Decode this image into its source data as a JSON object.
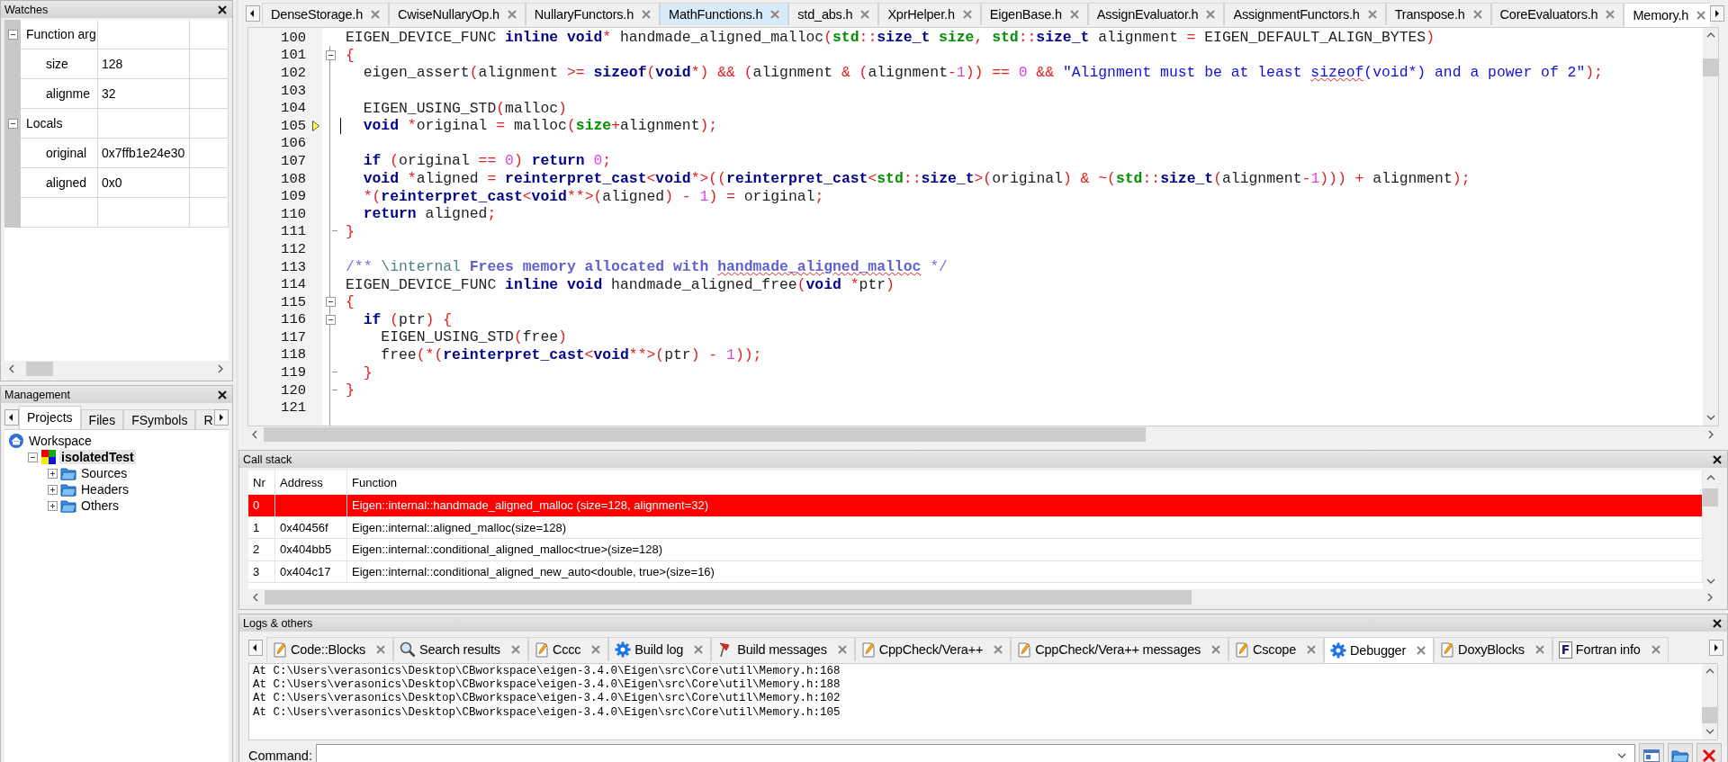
{
  "watches": {
    "title": "Watches",
    "groups": [
      {
        "label": "Function arg",
        "expanded": true,
        "items": [
          {
            "name": "size",
            "value": "128"
          },
          {
            "name": "alignme",
            "value": "32"
          }
        ]
      },
      {
        "label": "Locals",
        "expanded": true,
        "items": [
          {
            "name": "original",
            "value": "0x7ffb1e24e30"
          },
          {
            "name": "aligned",
            "value": "0x0"
          }
        ]
      }
    ]
  },
  "management": {
    "title": "Management",
    "tabs": [
      {
        "label": "Projects",
        "selected": true
      },
      {
        "label": "Files",
        "selected": false
      },
      {
        "label": "FSymbols",
        "selected": false
      },
      {
        "label": "R",
        "selected": false
      }
    ],
    "tree": [
      {
        "label": "Workspace",
        "kind": "workspace",
        "selected": false,
        "children": [
          {
            "label": "isolatedTest",
            "kind": "project",
            "expanded": true,
            "selected": true,
            "children": [
              {
                "label": "Sources",
                "kind": "folder",
                "expanded": false,
                "selected": false
              },
              {
                "label": "Headers",
                "kind": "folder",
                "expanded": false,
                "selected": false
              },
              {
                "label": "Others",
                "kind": "folder",
                "expanded": false,
                "selected": false
              }
            ]
          }
        ]
      }
    ]
  },
  "editor": {
    "tabs": [
      {
        "label": "DenseStorage.h",
        "selected": false,
        "hover": false
      },
      {
        "label": "CwiseNullaryOp.h",
        "selected": false,
        "hover": false
      },
      {
        "label": "NullaryFunctors.h",
        "selected": false,
        "hover": false
      },
      {
        "label": "MathFunctions.h",
        "selected": false,
        "hover": true
      },
      {
        "label": "std_abs.h",
        "selected": false,
        "hover": false
      },
      {
        "label": "XprHelper.h",
        "selected": false,
        "hover": false
      },
      {
        "label": "EigenBase.h",
        "selected": false,
        "hover": false
      },
      {
        "label": "AssignEvaluator.h",
        "selected": false,
        "hover": false
      },
      {
        "label": "AssignmentFunctors.h",
        "selected": false,
        "hover": false
      },
      {
        "label": "Transpose.h",
        "selected": false,
        "hover": false
      },
      {
        "label": "CoreEvaluators.h",
        "selected": false,
        "hover": false
      },
      {
        "label": "Memory.h",
        "selected": true,
        "hover": false
      }
    ],
    "lines": [
      {
        "n": "100",
        "s": [
          {
            "text": "EIGEN_DEVICE_FUNC ",
            "kind": "plain"
          },
          {
            "text": "inline void",
            "kind": "keyword"
          },
          {
            "text": "*",
            "kind": "operator"
          },
          {
            "text": " handmade_aligned_malloc",
            "kind": "plain"
          },
          {
            "text": "(",
            "kind": "operator"
          },
          {
            "text": "std",
            "kind": "identifier"
          },
          {
            "text": "::",
            "kind": "operator"
          },
          {
            "text": "size_t",
            "kind": "keyword"
          },
          {
            "text": " size",
            "kind": "identifier"
          },
          {
            "text": ", ",
            "kind": "operator"
          },
          {
            "text": "std",
            "kind": "identifier"
          },
          {
            "text": "::",
            "kind": "operator"
          },
          {
            "text": "size_t",
            "kind": "keyword"
          },
          {
            "text": " alignment ",
            "kind": "plain"
          },
          {
            "text": "=",
            "kind": "operator"
          },
          {
            "text": " EIGEN_DEFAULT_ALIGN_BYTES",
            "kind": "plain"
          },
          {
            "text": ")",
            "kind": "operator"
          }
        ]
      },
      {
        "n": "101",
        "fold_start": true,
        "s": [
          {
            "text": "{",
            "kind": "operator"
          }
        ]
      },
      {
        "n": "102",
        "s": [
          {
            "text": "  eigen_assert",
            "kind": "plain"
          },
          {
            "text": "(",
            "kind": "operator"
          },
          {
            "text": "alignment ",
            "kind": "plain"
          },
          {
            "text": ">=",
            "kind": "operator"
          },
          {
            "text": " sizeof",
            "kind": "keyword"
          },
          {
            "text": "(",
            "kind": "operator"
          },
          {
            "text": "void",
            "kind": "keyword"
          },
          {
            "text": "*) && (",
            "kind": "operator"
          },
          {
            "text": "alignment ",
            "kind": "plain"
          },
          {
            "text": "& (",
            "kind": "operator"
          },
          {
            "text": "alignment",
            "kind": "plain"
          },
          {
            "text": "-",
            "kind": "operator"
          },
          {
            "text": "1",
            "kind": "number"
          },
          {
            "text": ")) == ",
            "kind": "operator"
          },
          {
            "text": "0",
            "kind": "number"
          },
          {
            "text": " && ",
            "kind": "operator"
          },
          {
            "text": "\"Alignment must be at least ",
            "kind": "string"
          },
          {
            "text": "sizeof",
            "kind": "string",
            "misspelled": true
          },
          {
            "text": "(void*) and a power of 2\"",
            "kind": "string"
          },
          {
            "text": ");",
            "kind": "operator"
          }
        ]
      },
      {
        "n": "103"
      },
      {
        "n": "104",
        "s": [
          {
            "text": "  EIGEN_USING_STD",
            "kind": "plain"
          },
          {
            "text": "(",
            "kind": "operator"
          },
          {
            "text": "malloc",
            "kind": "plain"
          },
          {
            "text": ")",
            "kind": "operator"
          }
        ]
      },
      {
        "n": "105",
        "marker": true,
        "cursor": true,
        "s": [
          {
            "text": "  void",
            "kind": "keyword"
          },
          {
            "text": " *",
            "kind": "operator"
          },
          {
            "text": "original ",
            "kind": "plain"
          },
          {
            "text": "=",
            "kind": "operator"
          },
          {
            "text": " malloc",
            "kind": "plain"
          },
          {
            "text": "(",
            "kind": "operator"
          },
          {
            "text": "size",
            "kind": "identifier"
          },
          {
            "text": "+",
            "kind": "operator"
          },
          {
            "text": "alignment",
            "kind": "plain"
          },
          {
            "text": ");",
            "kind": "operator"
          }
        ]
      },
      {
        "n": "106"
      },
      {
        "n": "107",
        "s": [
          {
            "text": "  if",
            "kind": "keyword"
          },
          {
            "text": " (",
            "kind": "operator"
          },
          {
            "text": "original ",
            "kind": "plain"
          },
          {
            "text": "==",
            "kind": "operator"
          },
          {
            "text": " 0",
            "kind": "number"
          },
          {
            "text": ") ",
            "kind": "operator"
          },
          {
            "text": "return",
            "kind": "keyword"
          },
          {
            "text": " 0",
            "kind": "number"
          },
          {
            "text": ";",
            "kind": "operator"
          }
        ]
      },
      {
        "n": "108",
        "s": [
          {
            "text": "  void",
            "kind": "keyword"
          },
          {
            "text": " *",
            "kind": "operator"
          },
          {
            "text": "aligned ",
            "kind": "plain"
          },
          {
            "text": "=",
            "kind": "operator"
          },
          {
            "text": " reinterpret_cast",
            "kind": "keyword"
          },
          {
            "text": "<",
            "kind": "operator"
          },
          {
            "text": "void",
            "kind": "keyword"
          },
          {
            "text": "*>((",
            "kind": "operator"
          },
          {
            "text": "reinterpret_cast",
            "kind": "keyword"
          },
          {
            "text": "<",
            "kind": "operator"
          },
          {
            "text": "std",
            "kind": "identifier"
          },
          {
            "text": "::",
            "kind": "operator"
          },
          {
            "text": "size_t",
            "kind": "keyword"
          },
          {
            "text": ">(",
            "kind": "operator"
          },
          {
            "text": "original",
            "kind": "plain"
          },
          {
            "text": ") & ~(",
            "kind": "operator"
          },
          {
            "text": "std",
            "kind": "identifier"
          },
          {
            "text": "::",
            "kind": "operator"
          },
          {
            "text": "size_t",
            "kind": "keyword"
          },
          {
            "text": "(",
            "kind": "operator"
          },
          {
            "text": "alignment",
            "kind": "plain"
          },
          {
            "text": "-",
            "kind": "operator"
          },
          {
            "text": "1",
            "kind": "number"
          },
          {
            "text": "))) + ",
            "kind": "operator"
          },
          {
            "text": "alignment",
            "kind": "plain"
          },
          {
            "text": ");",
            "kind": "operator"
          }
        ]
      },
      {
        "n": "109",
        "s": [
          {
            "text": "  *(",
            "kind": "operator"
          },
          {
            "text": "reinterpret_cast",
            "kind": "keyword"
          },
          {
            "text": "<",
            "kind": "operator"
          },
          {
            "text": "void",
            "kind": "keyword"
          },
          {
            "text": "**>(",
            "kind": "operator"
          },
          {
            "text": "aligned",
            "kind": "plain"
          },
          {
            "text": ") - ",
            "kind": "operator"
          },
          {
            "text": "1",
            "kind": "number"
          },
          {
            "text": ") = ",
            "kind": "operator"
          },
          {
            "text": "original",
            "kind": "plain"
          },
          {
            "text": ";",
            "kind": "operator"
          }
        ]
      },
      {
        "n": "110",
        "s": [
          {
            "text": "  return",
            "kind": "keyword"
          },
          {
            "text": " aligned",
            "kind": "plain"
          },
          {
            "text": ";",
            "kind": "operator"
          }
        ]
      },
      {
        "n": "111",
        "fold_end": true,
        "s": [
          {
            "text": "}",
            "kind": "operator"
          }
        ]
      },
      {
        "n": "112"
      },
      {
        "n": "113",
        "s": [
          {
            "text": "/** ",
            "kind": "comment"
          },
          {
            "text": "\\internal",
            "kind": "doctag"
          },
          {
            "text": " Frees memory allocated with ",
            "kind": "doc"
          },
          {
            "text": "handmade_aligned_malloc",
            "kind": "doc",
            "misspelled": true
          },
          {
            "text": " */",
            "kind": "comment"
          }
        ]
      },
      {
        "n": "114",
        "s": [
          {
            "text": "EIGEN_DEVICE_FUNC ",
            "kind": "plain"
          },
          {
            "text": "inline void",
            "kind": "keyword"
          },
          {
            "text": " handmade_aligned_free",
            "kind": "plain"
          },
          {
            "text": "(",
            "kind": "operator"
          },
          {
            "text": "void",
            "kind": "keyword"
          },
          {
            "text": " *",
            "kind": "operator"
          },
          {
            "text": "ptr",
            "kind": "plain"
          },
          {
            "text": ")",
            "kind": "operator"
          }
        ]
      },
      {
        "n": "115",
        "fold_start": true,
        "s": [
          {
            "text": "{",
            "kind": "operator"
          }
        ]
      },
      {
        "n": "116",
        "fold_start": true,
        "s": [
          {
            "text": "  if",
            "kind": "keyword"
          },
          {
            "text": " (",
            "kind": "operator"
          },
          {
            "text": "ptr",
            "kind": "plain"
          },
          {
            "text": ") {",
            "kind": "operator"
          }
        ]
      },
      {
        "n": "117",
        "s": [
          {
            "text": "    EIGEN_USING_STD",
            "kind": "plain"
          },
          {
            "text": "(",
            "kind": "operator"
          },
          {
            "text": "free",
            "kind": "plain"
          },
          {
            "text": ")",
            "kind": "operator"
          }
        ]
      },
      {
        "n": "118",
        "s": [
          {
            "text": "    free",
            "kind": "plain"
          },
          {
            "text": "(*(",
            "kind": "operator"
          },
          {
            "text": "reinterpret_cast",
            "kind": "keyword"
          },
          {
            "text": "<",
            "kind": "operator"
          },
          {
            "text": "void",
            "kind": "keyword"
          },
          {
            "text": "**>(",
            "kind": "operator"
          },
          {
            "text": "ptr",
            "kind": "plain"
          },
          {
            "text": ") - ",
            "kind": "operator"
          },
          {
            "text": "1",
            "kind": "number"
          },
          {
            "text": "));",
            "kind": "operator"
          }
        ]
      },
      {
        "n": "119",
        "fold_end": true,
        "s": [
          {
            "text": "  }",
            "kind": "operator"
          }
        ]
      },
      {
        "n": "120",
        "fold_end": true,
        "s": [
          {
            "text": "}",
            "kind": "operator"
          }
        ]
      },
      {
        "n": "121"
      }
    ]
  },
  "call_stack": {
    "title": "Call stack",
    "columns": [
      "Nr",
      "Address",
      "Function"
    ],
    "rows": [
      {
        "nr": "0",
        "function": "Eigen::internal::handmade_aligned_malloc (size=128, alignment=32)",
        "selected": true
      },
      {
        "nr": "1",
        "address": "0x40456f",
        "function": "Eigen::internal::aligned_malloc(size=128)",
        "selected": false
      },
      {
        "nr": "2",
        "address": "0x404bb5",
        "function": "Eigen::internal::conditional_aligned_malloc<true>(size=128)",
        "selected": false
      },
      {
        "nr": "3",
        "address": "0x404c17",
        "function": "Eigen::internal::conditional_aligned_new_auto<double, true>(size=16)",
        "selected": false
      }
    ]
  },
  "logs": {
    "title": "Logs & others",
    "tabs": [
      {
        "label": "Code::Blocks",
        "kind": "pencil",
        "selected": false
      },
      {
        "label": "Search results",
        "kind": "search",
        "selected": false
      },
      {
        "label": "Cccc",
        "kind": "pencil",
        "selected": false
      },
      {
        "label": "Build log",
        "kind": "gear",
        "selected": false
      },
      {
        "label": "Build messages",
        "kind": "pin",
        "selected": false
      },
      {
        "label": "CppCheck/Vera++",
        "kind": "pencil",
        "selected": false
      },
      {
        "label": "CppCheck/Vera++ messages",
        "kind": "pencil",
        "selected": false
      },
      {
        "label": "Cscope",
        "kind": "pencil",
        "selected": false
      },
      {
        "label": "Debugger",
        "kind": "gear",
        "selected": true
      },
      {
        "label": "DoxyBlocks",
        "kind": "pencil",
        "selected": false
      },
      {
        "label": "Fortran info",
        "kind": "letter",
        "icon_text": "F",
        "selected": false
      }
    ],
    "lines": [
      "At C:\\Users\\verasonics\\Desktop\\CBworkspace\\eigen-3.4.0\\Eigen\\src\\Core\\util\\Memory.h:168",
      "At C:\\Users\\verasonics\\Desktop\\CBworkspace\\eigen-3.4.0\\Eigen\\src\\Core\\util\\Memory.h:188",
      "At C:\\Users\\verasonics\\Desktop\\CBworkspace\\eigen-3.4.0\\Eigen\\src\\Core\\util\\Memory.h:102",
      "At C:\\Users\\verasonics\\Desktop\\CBworkspace\\eigen-3.4.0\\Eigen\\src\\Core\\util\\Memory.h:105"
    ],
    "command": {
      "label": "Command:"
    }
  }
}
